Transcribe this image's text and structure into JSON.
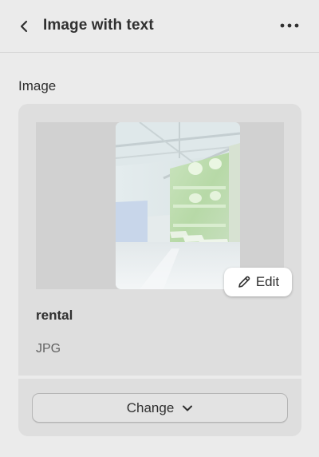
{
  "header": {
    "title": "Image with text",
    "back_icon": "chevron-left-icon",
    "more_icon": "more-horizontal-icon"
  },
  "image_section": {
    "label": "Image",
    "edit_label": "Edit",
    "file_name": "rental",
    "file_type": "JPG",
    "change_label": "Change",
    "change_icon": "chevron-down-icon"
  }
}
